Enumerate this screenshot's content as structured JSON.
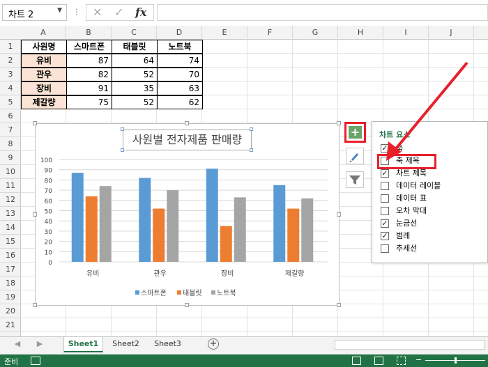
{
  "formula_bar": {
    "name_box": "차트 2",
    "fx": "fx",
    "cancel": "✕",
    "enter": "✓"
  },
  "columns": [
    "A",
    "B",
    "C",
    "D",
    "E",
    "F",
    "G",
    "H",
    "I",
    "J"
  ],
  "rows": [
    "1",
    "2",
    "3",
    "4",
    "5",
    "6",
    "7",
    "8",
    "9",
    "10",
    "11",
    "12",
    "13",
    "14",
    "15",
    "16",
    "17",
    "18",
    "19",
    "20",
    "21"
  ],
  "table": {
    "headers": [
      "사원명",
      "스마트폰",
      "태블릿",
      "노트북"
    ],
    "rows": [
      [
        "유비",
        "87",
        "64",
        "74"
      ],
      [
        "관우",
        "82",
        "52",
        "70"
      ],
      [
        "장비",
        "91",
        "35",
        "63"
      ],
      [
        "제갈량",
        "75",
        "52",
        "62"
      ]
    ]
  },
  "chart_data": {
    "type": "bar",
    "title": "사원별 전자제품 판매량",
    "categories": [
      "유비",
      "관우",
      "장비",
      "제갈량"
    ],
    "series": [
      {
        "name": "스마트폰",
        "values": [
          87,
          82,
          91,
          75
        ],
        "color": "#5b9bd5"
      },
      {
        "name": "태블릿",
        "values": [
          64,
          52,
          35,
          52
        ],
        "color": "#ed7d31"
      },
      {
        "name": "노트북",
        "values": [
          74,
          70,
          63,
          62
        ],
        "color": "#a5a5a5"
      }
    ],
    "ylim": [
      0,
      100
    ],
    "yticks": [
      "0",
      "10",
      "20",
      "30",
      "40",
      "50",
      "60",
      "70",
      "80",
      "90",
      "100"
    ],
    "grid": true,
    "legend": "bottom"
  },
  "chart_elements": {
    "title": "차트 요소",
    "items": [
      {
        "label": "축",
        "checked": true
      },
      {
        "label": "축 제목",
        "checked": false
      },
      {
        "label": "차트 제목",
        "checked": true
      },
      {
        "label": "데이터 레이블",
        "checked": false
      },
      {
        "label": "데이터 표",
        "checked": false
      },
      {
        "label": "오차 막대",
        "checked": false
      },
      {
        "label": "눈금선",
        "checked": true
      },
      {
        "label": "범례",
        "checked": true
      },
      {
        "label": "추세선",
        "checked": false
      }
    ]
  },
  "sheets": [
    "Sheet1",
    "Sheet2",
    "Sheet3"
  ],
  "status": {
    "ready": "준비"
  },
  "colors": {
    "accent": "#217346",
    "highlight": "#e8202a"
  }
}
